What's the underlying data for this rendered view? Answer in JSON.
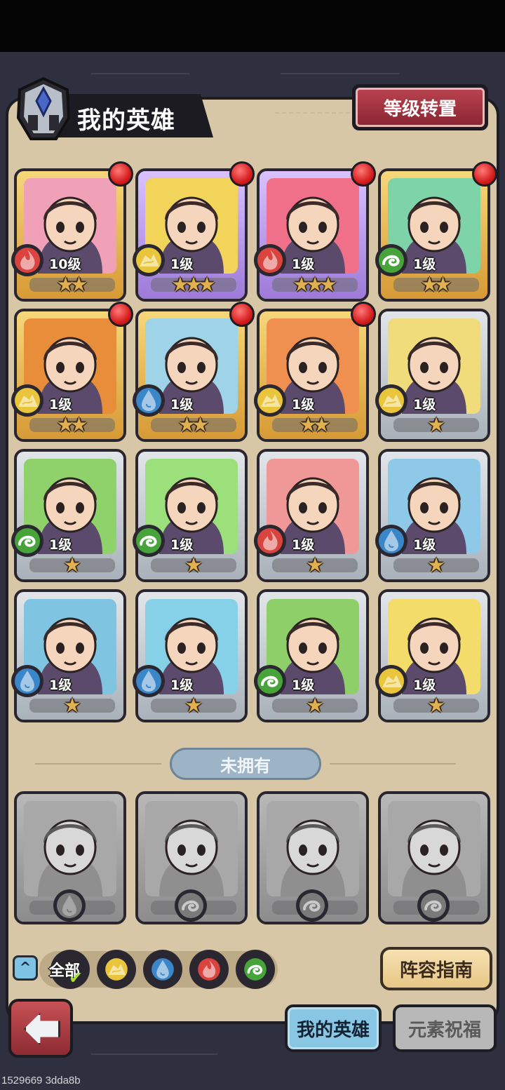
{
  "screen": {
    "title": "我的英雄",
    "transfer_button": "等级转置",
    "unowned_label": "未拥有",
    "guide_button": "阵容指南",
    "collapse_glyph": "^",
    "footer_id": "1529669 3dda8b"
  },
  "colors": {
    "fire": "#d9443f",
    "earth": "#e9c53c",
    "water": "#3b86c9",
    "wind": "#46a43a"
  },
  "heroes": [
    {
      "level": "10级",
      "stars": "★★",
      "element": "fire",
      "rarity": "gold",
      "badge": true,
      "hue": "#f0a1b8"
    },
    {
      "level": "1级",
      "stars": "★★★",
      "element": "earth",
      "rarity": "purple",
      "badge": true,
      "hue": "#f3d45a"
    },
    {
      "level": "1级",
      "stars": "★★★",
      "element": "fire",
      "rarity": "purple",
      "badge": true,
      "hue": "#f0708a"
    },
    {
      "level": "1级",
      "stars": "★★",
      "element": "wind",
      "rarity": "gold",
      "badge": true,
      "hue": "#7fd3a8"
    },
    {
      "level": "1级",
      "stars": "★★",
      "element": "earth",
      "rarity": "gold",
      "badge": true,
      "hue": "#e88e3a"
    },
    {
      "level": "1级",
      "stars": "★★",
      "element": "water",
      "rarity": "gold",
      "badge": true,
      "hue": "#9fd4e8"
    },
    {
      "level": "1级",
      "stars": "★★",
      "element": "earth",
      "rarity": "gold",
      "badge": true,
      "hue": "#f09050"
    },
    {
      "level": "1级",
      "stars": "★",
      "element": "earth",
      "rarity": "silver",
      "badge": false,
      "hue": "#f1dc7c"
    },
    {
      "level": "1级",
      "stars": "★",
      "element": "wind",
      "rarity": "silver",
      "badge": false,
      "hue": "#8fd16a"
    },
    {
      "level": "1级",
      "stars": "★",
      "element": "wind",
      "rarity": "silver",
      "badge": false,
      "hue": "#9be07a"
    },
    {
      "level": "1级",
      "stars": "★",
      "element": "fire",
      "rarity": "silver",
      "badge": false,
      "hue": "#f09898"
    },
    {
      "level": "1级",
      "stars": "★",
      "element": "water",
      "rarity": "silver",
      "badge": false,
      "hue": "#8ec9e8"
    },
    {
      "level": "1级",
      "stars": "★",
      "element": "water",
      "rarity": "silver",
      "badge": false,
      "hue": "#7fc4e0"
    },
    {
      "level": "1级",
      "stars": "★",
      "element": "water",
      "rarity": "silver",
      "badge": false,
      "hue": "#86d0e8"
    },
    {
      "level": "1级",
      "stars": "★",
      "element": "wind",
      "rarity": "silver",
      "badge": false,
      "hue": "#8fcf6a"
    },
    {
      "level": "1级",
      "stars": "★",
      "element": "earth",
      "rarity": "silver",
      "badge": false,
      "hue": "#f3dc6a"
    }
  ],
  "locked_heroes": [
    {
      "element": "water"
    },
    {
      "element": "wind"
    },
    {
      "element": "wind"
    },
    {
      "element": "wind"
    }
  ],
  "filters": [
    {
      "label": "全部",
      "selected": true,
      "element": "all"
    },
    {
      "label": "",
      "selected": false,
      "element": "earth"
    },
    {
      "label": "",
      "selected": false,
      "element": "water"
    },
    {
      "label": "",
      "selected": false,
      "element": "fire"
    },
    {
      "label": "",
      "selected": false,
      "element": "wind"
    }
  ],
  "tabs": [
    {
      "label": "我的英雄",
      "active": true
    },
    {
      "label": "元素祝福",
      "active": false
    }
  ],
  "icons": {
    "helmet": "hero-helmet-icon",
    "back": "back-arrow-icon",
    "check": "✔"
  }
}
